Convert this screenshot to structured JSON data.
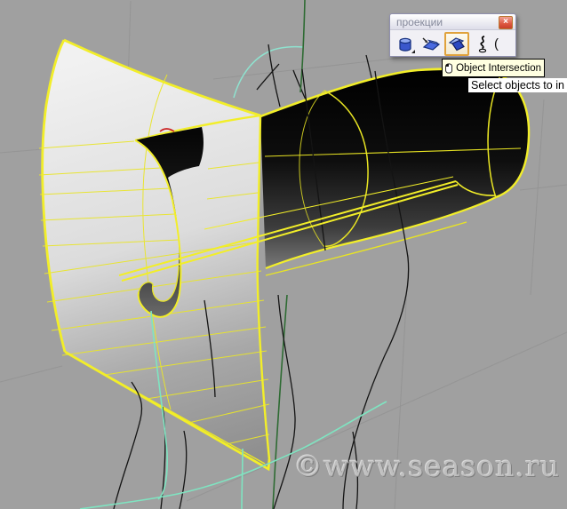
{
  "viewport": {
    "background_color": "#a0a0a0",
    "selection_color": "#f2ee29",
    "curve_colors": {
      "teal": "#7fe4c1",
      "dark_green": "#2e6b33",
      "red": "#cc2222",
      "black": "#1a1a1a"
    },
    "watermark": "©www.season.ru",
    "objects": [
      "selected-sheet-surface",
      "selected-flap-surface",
      "selected-cylinder",
      "freeform-curves"
    ]
  },
  "palette": {
    "title": "проекции",
    "close_glyph": "×",
    "buttons": [
      {
        "name": "projection-cylinder",
        "selected": false
      },
      {
        "name": "project-to-surface",
        "selected": false
      },
      {
        "name": "object-intersection",
        "selected": true
      },
      {
        "name": "curve-from-2-views",
        "selected": false,
        "suffix": "("
      }
    ]
  },
  "tooltip": {
    "text": "Object Intersection",
    "icon": "left-mouse-button-icon"
  },
  "prompt": {
    "text": "Select objects to in"
  }
}
